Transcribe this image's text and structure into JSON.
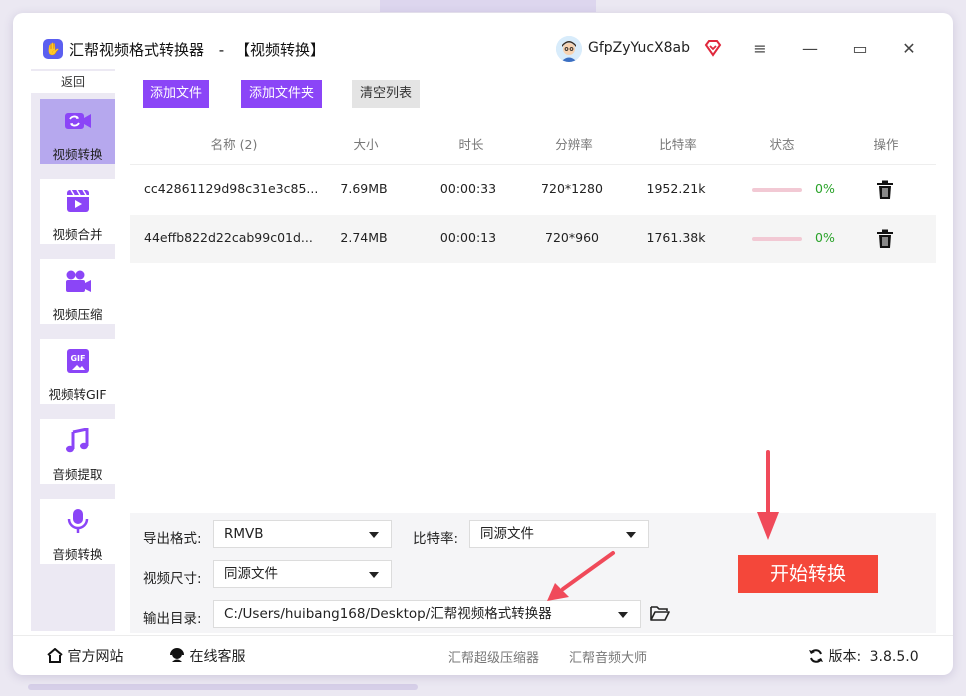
{
  "window": {
    "app_title": "汇帮视频格式转换器",
    "separator": "-",
    "page_title": "【视频转换】",
    "username": "GfpZyYucX8ab",
    "controls": {
      "menu": "≡",
      "minimize": "—",
      "maximize": "▭",
      "close": "✕"
    }
  },
  "sidebar": {
    "back_label": "返回",
    "items": [
      {
        "label": "视频转换",
        "icon": "video-convert-icon",
        "active": true
      },
      {
        "label": "视频合并",
        "icon": "video-merge-icon"
      },
      {
        "label": "视频压缩",
        "icon": "video-compress-icon"
      },
      {
        "label": "视频转GIF",
        "icon": "gif-icon"
      },
      {
        "label": "音频提取",
        "icon": "music-note-icon"
      },
      {
        "label": "音频转换",
        "icon": "microphone-icon"
      }
    ]
  },
  "toolbar": {
    "add_file": "添加文件",
    "add_folder": "添加文件夹",
    "clear_list": "清空列表"
  },
  "table": {
    "columns": [
      "名称 (2)",
      "大小",
      "时长",
      "分辨率",
      "比特率",
      "状态",
      "操作"
    ],
    "rows": [
      {
        "name": "cc42861129d98c31e3c85...",
        "size": "7.69MB",
        "duration": "00:00:33",
        "resolution": "720*1280",
        "bitrate": "1952.21k",
        "progress": "0%"
      },
      {
        "name": "44effb822d22cab99c01d...",
        "size": "2.74MB",
        "duration": "00:00:13",
        "resolution": "720*960",
        "bitrate": "1761.38k",
        "progress": "0%"
      }
    ]
  },
  "settings": {
    "format_label": "导出格式:",
    "format_value": "RMVB",
    "bitrate_label": "比特率:",
    "bitrate_value": "同源文件",
    "size_label": "视频尺寸:",
    "size_value": "同源文件",
    "output_label": "输出目录:",
    "output_value": "C:/Users/huibang168/Desktop/汇帮视频格式转换器"
  },
  "start_button": "开始转换",
  "footer": {
    "website": "官方网站",
    "support": "在线客服",
    "link1": "汇帮超级压缩器",
    "link2": "汇帮音频大师",
    "version_label": "版本:",
    "version": "3.8.5.0"
  },
  "colors": {
    "accent": "#8b45f7",
    "sidebar_active": "#b6a8ee",
    "start_button": "#f4473a",
    "progress_text": "#2aa32a",
    "arrow": "#f04a5a"
  }
}
